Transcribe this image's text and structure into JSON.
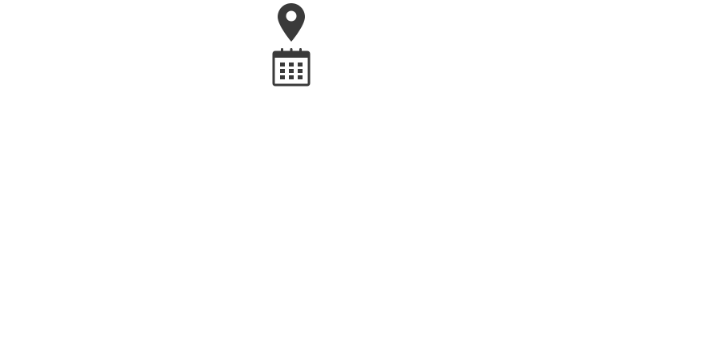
{
  "icons": {
    "location": "map-pin-icon",
    "date": "calendar-icon"
  },
  "colors": {
    "icon": "#3a3a3a",
    "background": "#ffffff"
  }
}
